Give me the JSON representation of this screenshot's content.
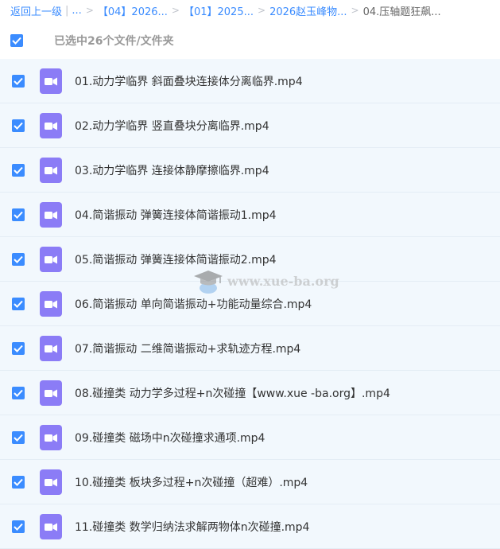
{
  "breadcrumb": {
    "back": "返回上一级",
    "ellipsis": "...",
    "items": [
      "【04】2026...",
      "【01】2025...",
      "2026赵玉峰物..."
    ],
    "current": "04.压轴题狂飙..."
  },
  "selection": {
    "summary": "已选中26个文件/文件夹"
  },
  "files": [
    "01.动力学临界 斜面叠块连接体分离临界.mp4",
    "02.动力学临界 竖直叠块分离临界.mp4",
    "03.动力学临界 连接体静摩擦临界.mp4",
    "04.简谐振动 弹簧连接体简谐振动1.mp4",
    "05.简谐振动 弹簧连接体简谐振动2.mp4",
    "06.简谐振动 单向简谐振动+功能动量综合.mp4",
    "07.简谐振动 二维简谐振动+求轨迹方程.mp4",
    "08.碰撞类 动力学多过程+n次碰撞【www.xue -ba.org】.mp4",
    "09.碰撞类 磁场中n次碰撞求通项.mp4",
    "10.碰撞类 板块多过程+n次碰撞（超难）.mp4",
    "11.碰撞类 数学归纳法求解两物体n次碰撞.mp4"
  ],
  "watermark": "www.xue-ba.org",
  "colors": {
    "accent": "#3b8cff",
    "video_icon": "#8b7cf6",
    "row_bg": "#f2f8fd"
  },
  "icons": {
    "checkbox": "checkbox-checked-icon",
    "file": "video-file-icon"
  }
}
